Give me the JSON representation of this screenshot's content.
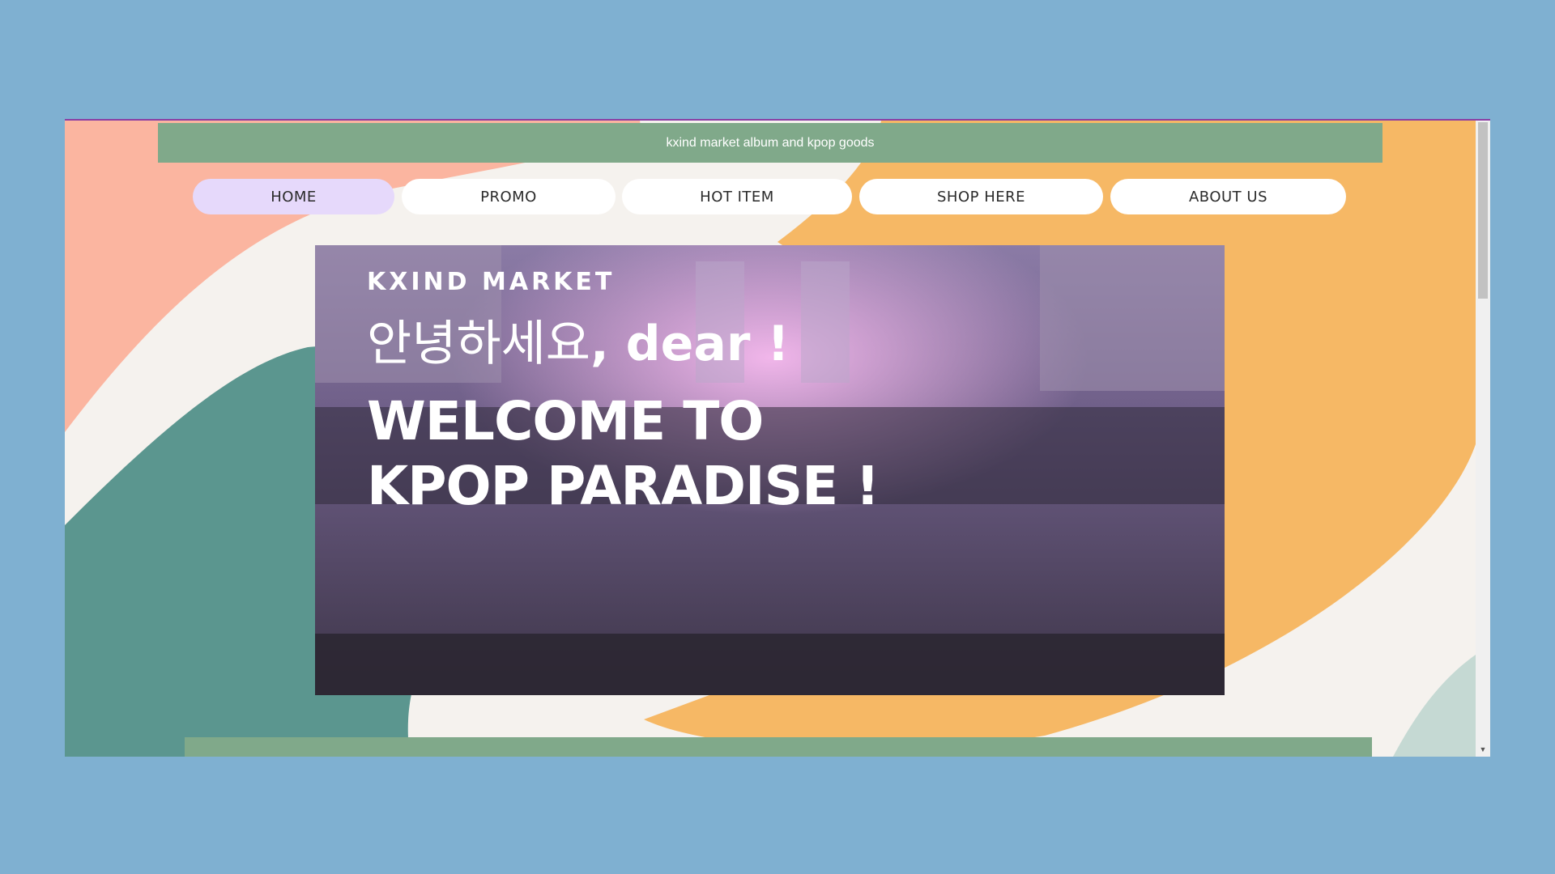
{
  "top_banner": {
    "text": "kxind market album and kpop goods"
  },
  "nav": {
    "items": [
      {
        "label": "HOME",
        "active": true
      },
      {
        "label": "PROMO",
        "active": false
      },
      {
        "label": "HOT ITEM",
        "active": false
      },
      {
        "label": "SHOP HERE",
        "active": false
      },
      {
        "label": "ABOUT US",
        "active": false
      }
    ]
  },
  "hero": {
    "brand": "KXIND MARKET",
    "greeting_korean": "안녕하세요",
    "greeting_english": ", dear !",
    "headline_line1": "WELCOME TO",
    "headline_line2": "KPOP PARADISE !"
  },
  "colors": {
    "page_bg": "#7fb0d1",
    "banner_green": "#80a98a",
    "nav_active": "#e6d9fb",
    "blob_peach": "#fbb5a0",
    "blob_orange": "#f6b865",
    "blob_teal": "#5b968f",
    "blob_mint": "#c5d9d3",
    "cream": "#f5f2ee"
  },
  "icons": {
    "scroll_down": "triangle-down-icon"
  }
}
